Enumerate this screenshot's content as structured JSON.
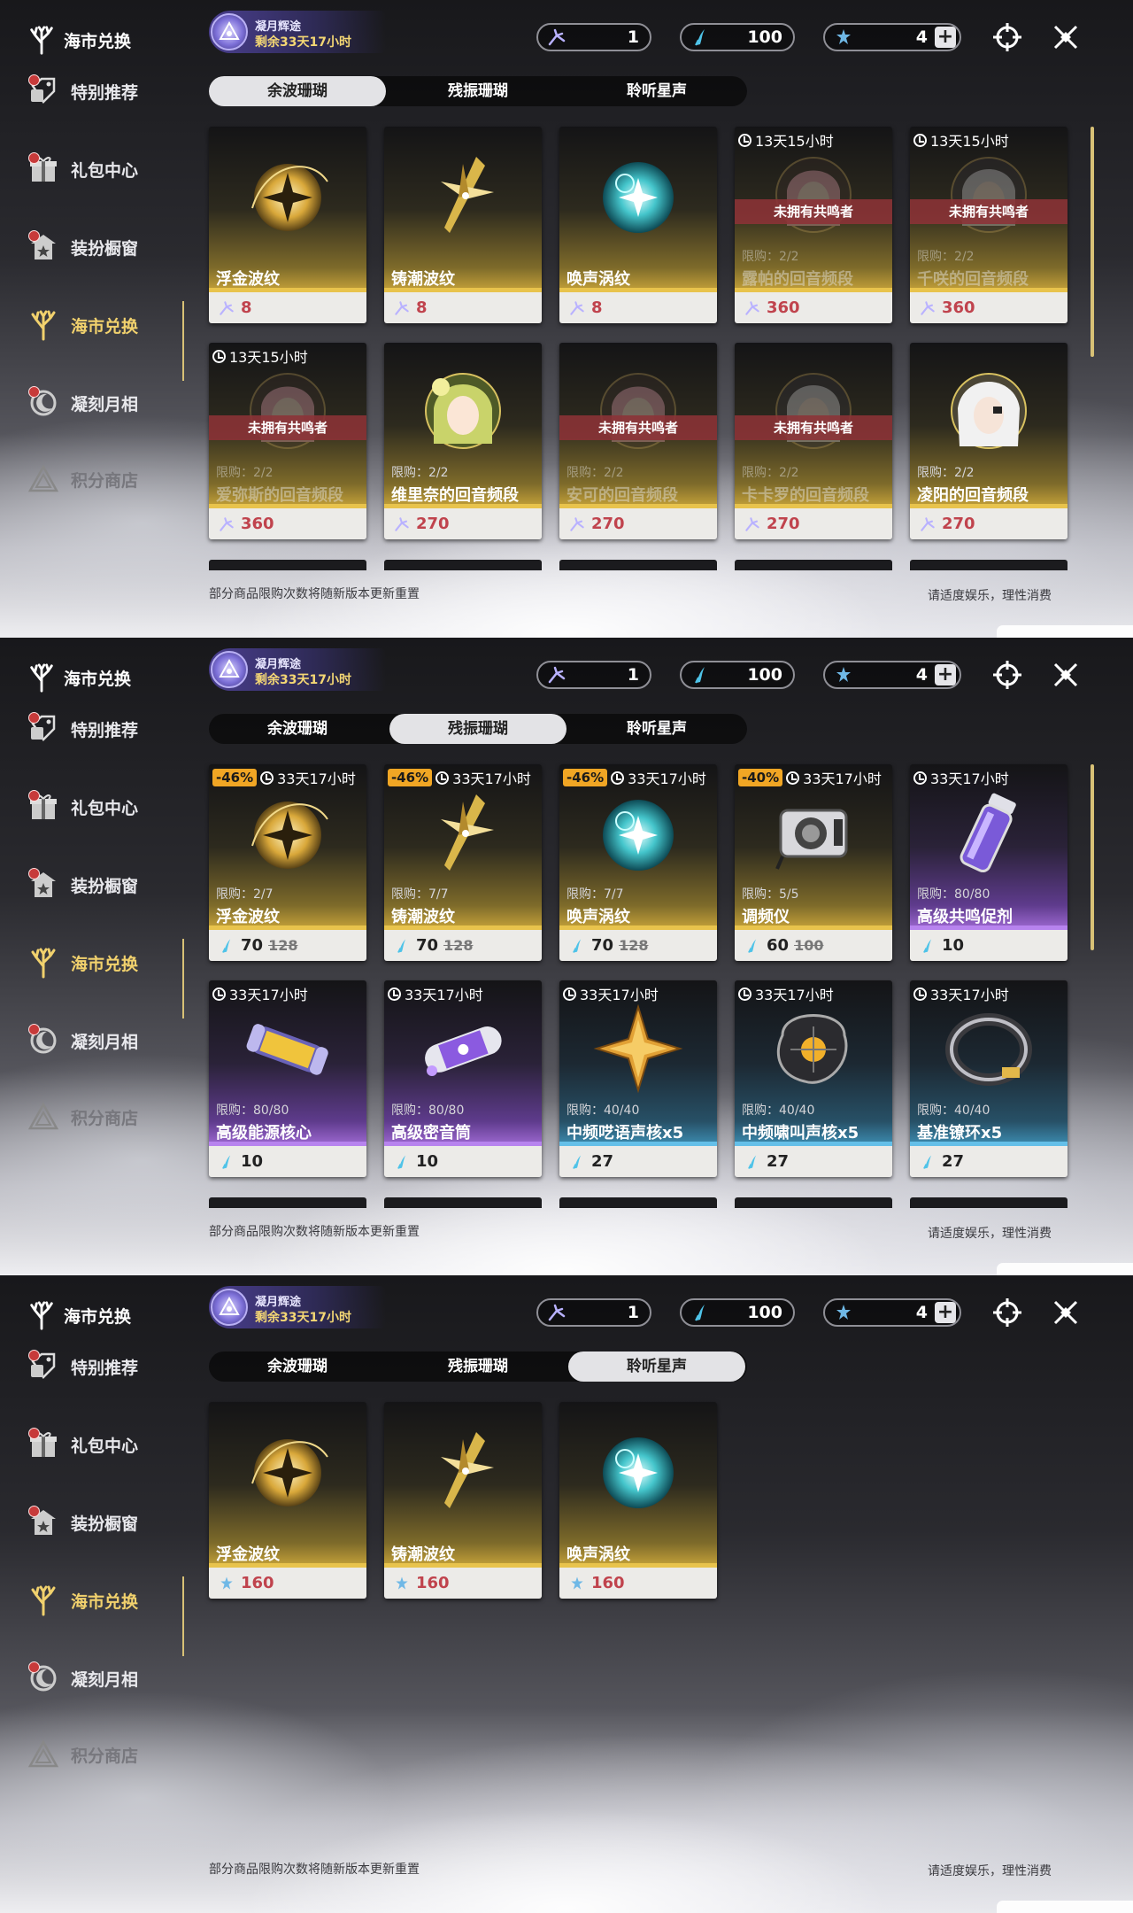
{
  "screens": [
    {
      "sidebar": {
        "brand": "海市兑换",
        "items": [
          {
            "label": "特别推荐",
            "icon": "tag-icon",
            "state": "normal",
            "badge": true
          },
          {
            "label": "礼包中心",
            "icon": "gift-icon",
            "state": "normal",
            "badge": true
          },
          {
            "label": "装扮橱窗",
            "icon": "wardrobe-icon",
            "state": "normal",
            "badge": true
          },
          {
            "label": "海市兑换",
            "icon": "coral-icon",
            "state": "active",
            "badge": false
          },
          {
            "label": "凝刻月相",
            "icon": "moon-icon",
            "state": "normal",
            "badge": true
          },
          {
            "label": "积分商店",
            "icon": "triangle-icon",
            "state": "dim",
            "badge": false
          }
        ]
      },
      "event": {
        "title": "凝月辉途",
        "time": "剩余33天17小时"
      },
      "currencies": [
        {
          "icon": "coral-feather-icon",
          "value": "1"
        },
        {
          "icon": "blue-feather-icon",
          "value": "100"
        },
        {
          "icon": "star-feather-icon",
          "value": "4",
          "plus": "+"
        }
      ],
      "tabs": [
        "余波珊瑚",
        "残振珊瑚",
        "聆听星声"
      ],
      "selected_tab": 0,
      "cards": [
        {
          "name": "浮金波纹",
          "rarity": "gold",
          "art": "gold-orb",
          "price": "8",
          "price_icon": "coral-feather-icon"
        },
        {
          "name": "铸潮波纹",
          "rarity": "gold",
          "art": "gold-blade",
          "price": "8",
          "price_icon": "coral-feather-icon"
        },
        {
          "name": "唤声涡纹",
          "rarity": "gold",
          "art": "teal-orb",
          "price": "8",
          "price_icon": "coral-feather-icon"
        },
        {
          "name": "露帕的回音频段",
          "rarity": "gold",
          "art": "portrait-pink",
          "timer": "13天15小时",
          "locked": true,
          "locked_label": "未拥有共鸣者",
          "limit": "限购：2/2",
          "price": "360",
          "price_icon": "coral-feather-icon"
        },
        {
          "name": "千咲的回音频段",
          "rarity": "gold",
          "art": "portrait-silver",
          "timer": "13天15小时",
          "locked": true,
          "locked_label": "未拥有共鸣者",
          "limit": "限购：2/2",
          "price": "360",
          "price_icon": "coral-feather-icon"
        },
        {
          "name": "爱弥斯的回音频段",
          "rarity": "gold",
          "art": "portrait-pink",
          "timer": "13天15小时",
          "locked": true,
          "locked_label": "未拥有共鸣者",
          "limit": "限购：2/2",
          "price": "360",
          "price_icon": "coral-feather-icon"
        },
        {
          "name": "维里奈的回音频段",
          "rarity": "gold",
          "art": "portrait-green",
          "limit": "限购：2/2",
          "price": "270",
          "price_icon": "coral-feather-icon"
        },
        {
          "name": "安可的回音频段",
          "rarity": "gold",
          "art": "portrait-pink",
          "locked": true,
          "locked_label": "未拥有共鸣者",
          "limit": "限购：2/2",
          "price": "270",
          "price_icon": "coral-feather-icon"
        },
        {
          "name": "卡卡罗的回音频段",
          "rarity": "gold",
          "art": "portrait-silver",
          "locked": true,
          "locked_label": "未拥有共鸣者",
          "limit": "限购：2/2",
          "price": "270",
          "price_icon": "coral-feather-icon"
        },
        {
          "name": "凌阳的回音频段",
          "rarity": "gold",
          "art": "portrait-white",
          "limit": "限购：2/2",
          "price": "270",
          "price_icon": "coral-feather-icon"
        }
      ],
      "peek_row": true,
      "footer_left": "部分商品限购次数将随新版本更新重置",
      "footer_right": "请适度娱乐，理性消费"
    },
    {
      "sidebar": {
        "brand": "海市兑换",
        "items": [
          {
            "label": "特别推荐",
            "icon": "tag-icon",
            "state": "normal",
            "badge": true
          },
          {
            "label": "礼包中心",
            "icon": "gift-icon",
            "state": "normal",
            "badge": true
          },
          {
            "label": "装扮橱窗",
            "icon": "wardrobe-icon",
            "state": "normal",
            "badge": true
          },
          {
            "label": "海市兑换",
            "icon": "coral-icon",
            "state": "active",
            "badge": false
          },
          {
            "label": "凝刻月相",
            "icon": "moon-icon",
            "state": "normal",
            "badge": true
          },
          {
            "label": "积分商店",
            "icon": "triangle-icon",
            "state": "dim",
            "badge": false
          }
        ]
      },
      "event": {
        "title": "凝月辉途",
        "time": "剩余33天17小时"
      },
      "currencies": [
        {
          "icon": "coral-feather-icon",
          "value": "1"
        },
        {
          "icon": "blue-feather-icon",
          "value": "100"
        },
        {
          "icon": "star-feather-icon",
          "value": "4",
          "plus": "+"
        }
      ],
      "tabs": [
        "余波珊瑚",
        "残振珊瑚",
        "聆听星声"
      ],
      "selected_tab": 1,
      "cards": [
        {
          "name": "浮金波纹",
          "rarity": "gold",
          "art": "gold-orb",
          "discount": "-46%",
          "timer": "33天17小时",
          "limit": "限购：2/7",
          "price": "70",
          "old_price": "128",
          "price_icon": "blue-feather-icon"
        },
        {
          "name": "铸潮波纹",
          "rarity": "gold",
          "art": "gold-blade",
          "discount": "-46%",
          "timer": "33天17小时",
          "limit": "限购：7/7",
          "price": "70",
          "old_price": "128",
          "price_icon": "blue-feather-icon"
        },
        {
          "name": "唤声涡纹",
          "rarity": "gold",
          "art": "teal-orb",
          "discount": "-46%",
          "timer": "33天17小时",
          "limit": "限购：7/7",
          "price": "70",
          "old_price": "128",
          "price_icon": "blue-feather-icon"
        },
        {
          "name": "调频仪",
          "rarity": "gold",
          "art": "device",
          "discount": "-40%",
          "timer": "33天17小时",
          "limit": "限购：5/5",
          "price": "60",
          "old_price": "100",
          "price_icon": "blue-feather-icon"
        },
        {
          "name": "高级共鸣促剂",
          "rarity": "purple",
          "art": "vial",
          "timer": "33天17小时",
          "limit": "限购：80/80",
          "price": "10",
          "price_icon": "blue-feather-icon"
        },
        {
          "name": "高级能源核心",
          "rarity": "purple",
          "art": "capsule-gold",
          "timer": "33天17小时",
          "limit": "限购：80/80",
          "price": "10",
          "price_icon": "blue-feather-icon"
        },
        {
          "name": "高级密音筒",
          "rarity": "purple",
          "art": "capsule-purple",
          "timer": "33天17小时",
          "limit": "限购：80/80",
          "price": "10",
          "price_icon": "blue-feather-icon"
        },
        {
          "name": "中频呓语声核x5",
          "rarity": "blue",
          "art": "star-core",
          "timer": "33天17小时",
          "limit": "限购：40/40",
          "price": "27",
          "price_icon": "blue-feather-icon"
        },
        {
          "name": "中频啸叫声核x5",
          "rarity": "blue",
          "art": "dark-core",
          "timer": "33天17小时",
          "limit": "限购：40/40",
          "price": "27",
          "price_icon": "blue-feather-icon"
        },
        {
          "name": "基准镣环x5",
          "rarity": "blue",
          "art": "ring",
          "timer": "33天17小时",
          "limit": "限购：40/40",
          "price": "27",
          "price_icon": "blue-feather-icon"
        }
      ],
      "peek_row": true,
      "footer_left": "部分商品限购次数将随新版本更新重置",
      "footer_right": "请适度娱乐，理性消费"
    },
    {
      "sidebar": {
        "brand": "海市兑换",
        "items": [
          {
            "label": "特别推荐",
            "icon": "tag-icon",
            "state": "normal",
            "badge": true
          },
          {
            "label": "礼包中心",
            "icon": "gift-icon",
            "state": "normal",
            "badge": true
          },
          {
            "label": "装扮橱窗",
            "icon": "wardrobe-icon",
            "state": "normal",
            "badge": true
          },
          {
            "label": "海市兑换",
            "icon": "coral-icon",
            "state": "active",
            "badge": false
          },
          {
            "label": "凝刻月相",
            "icon": "moon-icon",
            "state": "normal",
            "badge": true
          },
          {
            "label": "积分商店",
            "icon": "triangle-icon",
            "state": "dim",
            "badge": false
          }
        ]
      },
      "event": {
        "title": "凝月辉途",
        "time": "剩余33天17小时"
      },
      "currencies": [
        {
          "icon": "coral-feather-icon",
          "value": "1"
        },
        {
          "icon": "blue-feather-icon",
          "value": "100"
        },
        {
          "icon": "star-feather-icon",
          "value": "4",
          "plus": "+"
        }
      ],
      "tabs": [
        "余波珊瑚",
        "残振珊瑚",
        "聆听星声"
      ],
      "selected_tab": 2,
      "cards": [
        {
          "name": "浮金波纹",
          "rarity": "gold",
          "art": "gold-orb",
          "price": "160",
          "price_icon": "star-feather-icon"
        },
        {
          "name": "铸潮波纹",
          "rarity": "gold",
          "art": "gold-blade",
          "price": "160",
          "price_icon": "star-feather-icon"
        },
        {
          "name": "唤声涡纹",
          "rarity": "gold",
          "art": "teal-orb",
          "price": "160",
          "price_icon": "star-feather-icon"
        }
      ],
      "peek_row": false,
      "footer_left": "部分商品限购次数将随新版本更新重置",
      "footer_right": "请适度娱乐，理性消费"
    }
  ],
  "colors": {
    "active": "#f1d16d",
    "accent_gold": "#e8c34c",
    "accent_purple": "#b783ee",
    "accent_blue": "#64bfe8",
    "locked_band": "#8c3237",
    "discount": "#f1a624",
    "price_red": "#c0434d"
  }
}
